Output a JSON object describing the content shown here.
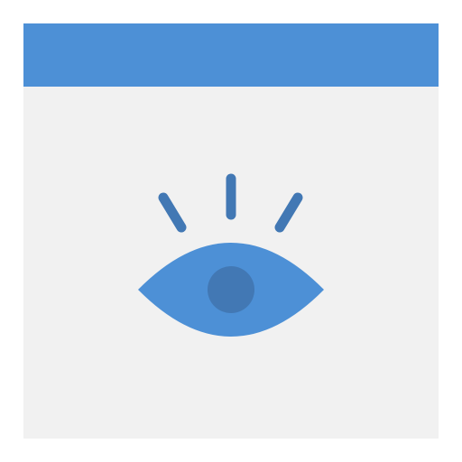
{
  "icon": {
    "name": "browser-window-eye-icon",
    "colors": {
      "titlebar": "#4d90d6",
      "window_body": "#f1f1f1",
      "eye": "#4d90d6",
      "pupil": "#4278b4",
      "eyelash": "#4278b4",
      "page_background": "#ffffff"
    },
    "parts": [
      "window-titlebar",
      "window-body",
      "eye-icon",
      "pupil",
      "eyelashes"
    ]
  }
}
